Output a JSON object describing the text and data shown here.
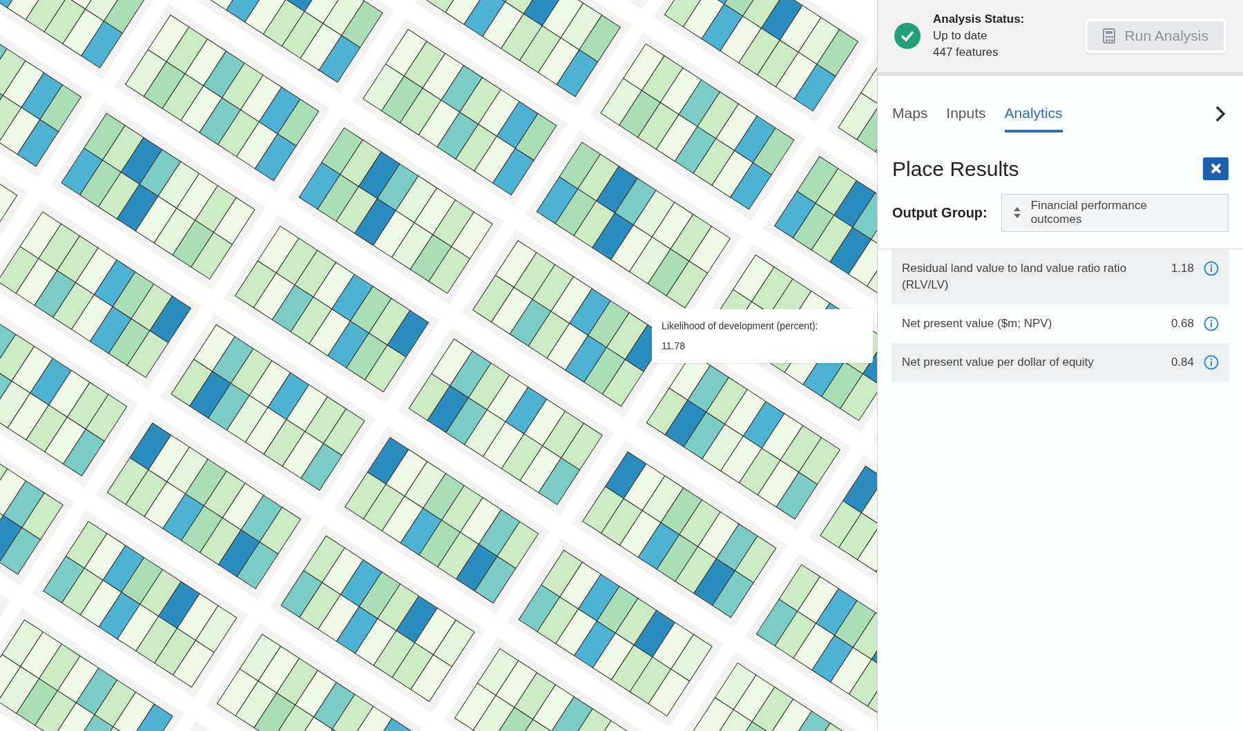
{
  "status": {
    "title": "Analysis Status:",
    "state": "Up to date",
    "features": "447 features",
    "ok": true
  },
  "run_button": {
    "label": "Run Analysis",
    "disabled": true
  },
  "tabs": [
    {
      "label": "Maps",
      "selected": false
    },
    {
      "label": "Inputs",
      "selected": false
    },
    {
      "label": "Analytics",
      "selected": true
    }
  ],
  "panel": {
    "title": "Place Results",
    "output_group_label": "Output Group:",
    "output_group_value": "Financial performance outcomes"
  },
  "results": [
    {
      "label": "Residual land value to land value ratio ratio (RLV/LV)",
      "value": "1.18"
    },
    {
      "label": "Net present value ($m; NPV)",
      "value": "0.68"
    },
    {
      "label": "Net present value per dollar of equity",
      "value": "0.84"
    }
  ],
  "tooltip": {
    "label": "Likelihood of development (percent):",
    "value": "11.78"
  }
}
